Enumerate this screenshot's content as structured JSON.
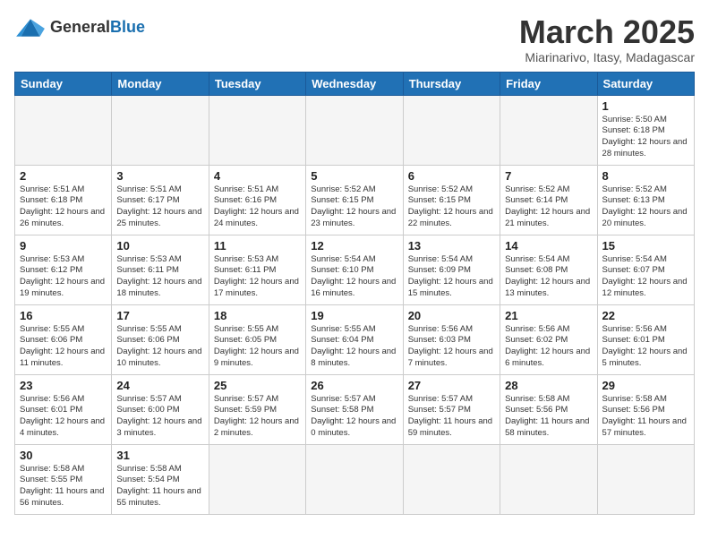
{
  "header": {
    "logo_general": "General",
    "logo_blue": "Blue",
    "month_title": "March 2025",
    "subtitle": "Miarinarivo, Itasy, Madagascar"
  },
  "days_of_week": [
    "Sunday",
    "Monday",
    "Tuesday",
    "Wednesday",
    "Thursday",
    "Friday",
    "Saturday"
  ],
  "weeks": [
    [
      {
        "day": "",
        "info": ""
      },
      {
        "day": "",
        "info": ""
      },
      {
        "day": "",
        "info": ""
      },
      {
        "day": "",
        "info": ""
      },
      {
        "day": "",
        "info": ""
      },
      {
        "day": "",
        "info": ""
      },
      {
        "day": "1",
        "info": "Sunrise: 5:50 AM\nSunset: 6:18 PM\nDaylight: 12 hours\nand 28 minutes."
      }
    ],
    [
      {
        "day": "2",
        "info": "Sunrise: 5:51 AM\nSunset: 6:18 PM\nDaylight: 12 hours\nand 26 minutes."
      },
      {
        "day": "3",
        "info": "Sunrise: 5:51 AM\nSunset: 6:17 PM\nDaylight: 12 hours\nand 25 minutes."
      },
      {
        "day": "4",
        "info": "Sunrise: 5:51 AM\nSunset: 6:16 PM\nDaylight: 12 hours\nand 24 minutes."
      },
      {
        "day": "5",
        "info": "Sunrise: 5:52 AM\nSunset: 6:15 PM\nDaylight: 12 hours\nand 23 minutes."
      },
      {
        "day": "6",
        "info": "Sunrise: 5:52 AM\nSunset: 6:15 PM\nDaylight: 12 hours\nand 22 minutes."
      },
      {
        "day": "7",
        "info": "Sunrise: 5:52 AM\nSunset: 6:14 PM\nDaylight: 12 hours\nand 21 minutes."
      },
      {
        "day": "8",
        "info": "Sunrise: 5:52 AM\nSunset: 6:13 PM\nDaylight: 12 hours\nand 20 minutes."
      }
    ],
    [
      {
        "day": "9",
        "info": "Sunrise: 5:53 AM\nSunset: 6:12 PM\nDaylight: 12 hours\nand 19 minutes."
      },
      {
        "day": "10",
        "info": "Sunrise: 5:53 AM\nSunset: 6:11 PM\nDaylight: 12 hours\nand 18 minutes."
      },
      {
        "day": "11",
        "info": "Sunrise: 5:53 AM\nSunset: 6:11 PM\nDaylight: 12 hours\nand 17 minutes."
      },
      {
        "day": "12",
        "info": "Sunrise: 5:54 AM\nSunset: 6:10 PM\nDaylight: 12 hours\nand 16 minutes."
      },
      {
        "day": "13",
        "info": "Sunrise: 5:54 AM\nSunset: 6:09 PM\nDaylight: 12 hours\nand 15 minutes."
      },
      {
        "day": "14",
        "info": "Sunrise: 5:54 AM\nSunset: 6:08 PM\nDaylight: 12 hours\nand 13 minutes."
      },
      {
        "day": "15",
        "info": "Sunrise: 5:54 AM\nSunset: 6:07 PM\nDaylight: 12 hours\nand 12 minutes."
      }
    ],
    [
      {
        "day": "16",
        "info": "Sunrise: 5:55 AM\nSunset: 6:06 PM\nDaylight: 12 hours\nand 11 minutes."
      },
      {
        "day": "17",
        "info": "Sunrise: 5:55 AM\nSunset: 6:06 PM\nDaylight: 12 hours\nand 10 minutes."
      },
      {
        "day": "18",
        "info": "Sunrise: 5:55 AM\nSunset: 6:05 PM\nDaylight: 12 hours\nand 9 minutes."
      },
      {
        "day": "19",
        "info": "Sunrise: 5:55 AM\nSunset: 6:04 PM\nDaylight: 12 hours\nand 8 minutes."
      },
      {
        "day": "20",
        "info": "Sunrise: 5:56 AM\nSunset: 6:03 PM\nDaylight: 12 hours\nand 7 minutes."
      },
      {
        "day": "21",
        "info": "Sunrise: 5:56 AM\nSunset: 6:02 PM\nDaylight: 12 hours\nand 6 minutes."
      },
      {
        "day": "22",
        "info": "Sunrise: 5:56 AM\nSunset: 6:01 PM\nDaylight: 12 hours\nand 5 minutes."
      }
    ],
    [
      {
        "day": "23",
        "info": "Sunrise: 5:56 AM\nSunset: 6:01 PM\nDaylight: 12 hours\nand 4 minutes."
      },
      {
        "day": "24",
        "info": "Sunrise: 5:57 AM\nSunset: 6:00 PM\nDaylight: 12 hours\nand 3 minutes."
      },
      {
        "day": "25",
        "info": "Sunrise: 5:57 AM\nSunset: 5:59 PM\nDaylight: 12 hours\nand 2 minutes."
      },
      {
        "day": "26",
        "info": "Sunrise: 5:57 AM\nSunset: 5:58 PM\nDaylight: 12 hours\nand 0 minutes."
      },
      {
        "day": "27",
        "info": "Sunrise: 5:57 AM\nSunset: 5:57 PM\nDaylight: 11 hours\nand 59 minutes."
      },
      {
        "day": "28",
        "info": "Sunrise: 5:58 AM\nSunset: 5:56 PM\nDaylight: 11 hours\nand 58 minutes."
      },
      {
        "day": "29",
        "info": "Sunrise: 5:58 AM\nSunset: 5:56 PM\nDaylight: 11 hours\nand 57 minutes."
      }
    ],
    [
      {
        "day": "30",
        "info": "Sunrise: 5:58 AM\nSunset: 5:55 PM\nDaylight: 11 hours\nand 56 minutes."
      },
      {
        "day": "31",
        "info": "Sunrise: 5:58 AM\nSunset: 5:54 PM\nDaylight: 11 hours\nand 55 minutes."
      },
      {
        "day": "",
        "info": ""
      },
      {
        "day": "",
        "info": ""
      },
      {
        "day": "",
        "info": ""
      },
      {
        "day": "",
        "info": ""
      },
      {
        "day": "",
        "info": ""
      }
    ]
  ]
}
